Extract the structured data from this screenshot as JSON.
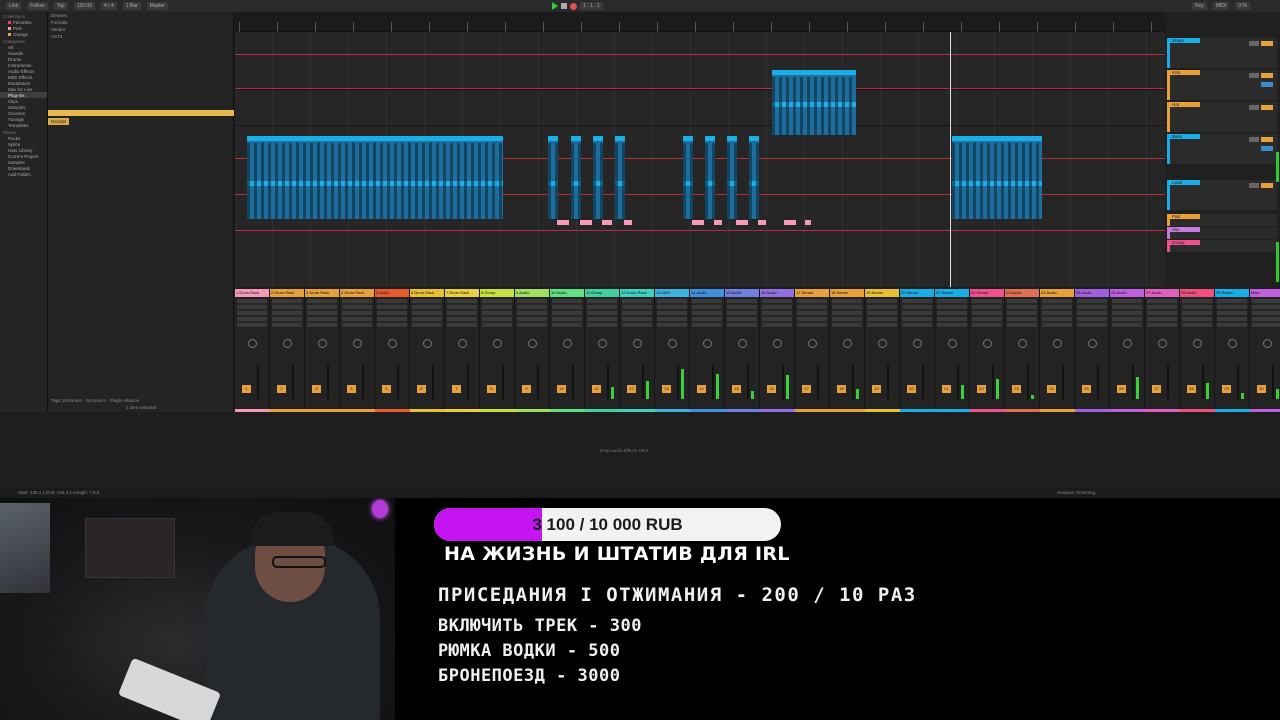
{
  "daw": {
    "transport": {
      "items": [
        "Link",
        "Follow",
        "Tap",
        "120.00",
        "4 / 4",
        "1 Bar",
        "Master"
      ],
      "position": "1 . 1 . 1",
      "right": [
        "Key",
        "MIDI",
        "0 %"
      ]
    },
    "browser": {
      "collections_label": "Collections",
      "collections": [
        "Favorites",
        "Pink",
        "Orange"
      ],
      "categories_label": "Categories",
      "categories": [
        "All",
        "Sounds",
        "Drums",
        "Instruments",
        "Audio Effects",
        "MIDI Effects",
        "Modulators",
        "Max for Live",
        "Plug-Ins",
        "Clips",
        "Samples",
        "Grooves",
        "Tunings",
        "Templates"
      ],
      "places_label": "Places",
      "places": [
        "Packs",
        "Splice",
        "User Library",
        "Current Project",
        "samples",
        "Downloads",
        "Add Folder..."
      ],
      "filters": [
        "Devices",
        "Formats",
        "Vendor",
        "VST3"
      ],
      "results_label": "Results",
      "tags_label": "Tags",
      "tags": [
        "Distortion",
        "Dynamics",
        "Plugin Alliance"
      ],
      "selection_status": "1 item selected"
    },
    "track_headers": [
      "Snare",
      "Kick",
      "Hat",
      "Bass",
      "Lead",
      "Pad",
      "Vox",
      "Group"
    ],
    "mixer_strips": [
      "1 Drum Rack",
      "2 Drum Rack",
      "3 Drum Rack",
      "4 Drum Rack",
      "5 Audio",
      "6 Drum Rack",
      "7 Drum Rack",
      "8 Group",
      "9 Audio",
      "10 Audio",
      "11 Group",
      "12 Drum Rack",
      "13 MIDI",
      "14 Audio",
      "15 Audio",
      "16 Audio",
      "17 Serum",
      "18 Serum",
      "19 Serum",
      "20 Serum",
      "21 Serum",
      "22 Serum",
      "23 Audio",
      "24 Audio",
      "25 Audio",
      "26 Audio",
      "27 Audio",
      "28 Audio",
      "29 Return",
      "Main"
    ],
    "drop_hint": "Drop Audio Effects Here",
    "status_left": "Start: 136.1.1  End: 145.4.1  Length: 7.0.0",
    "status_right": "Analysis: Scanning..."
  },
  "overlay": {
    "goal": {
      "text": "3 100 / 10 000 RUB",
      "progress": 0.31,
      "caption": "НА ЖИЗНЬ И ШТАТИВ ДЛЯ IRL",
      "fill_color": "#c414f2"
    },
    "rules": [
      "ПРИСЕДАНИЯ I ОТЖИМАНИЯ - 200 / 10 РАЗ",
      "ВКЛЮЧИТЬ ТРЕК - 300",
      "РЮМКА ВОДКИ - 500",
      "БРОНЕПОЕЗД - 3000"
    ]
  },
  "colors": {
    "clip_blue": "#19aee8",
    "automation_red": "#b53030",
    "clip_pink": "#f59bb7",
    "accent_orange": "#e8a03a"
  }
}
